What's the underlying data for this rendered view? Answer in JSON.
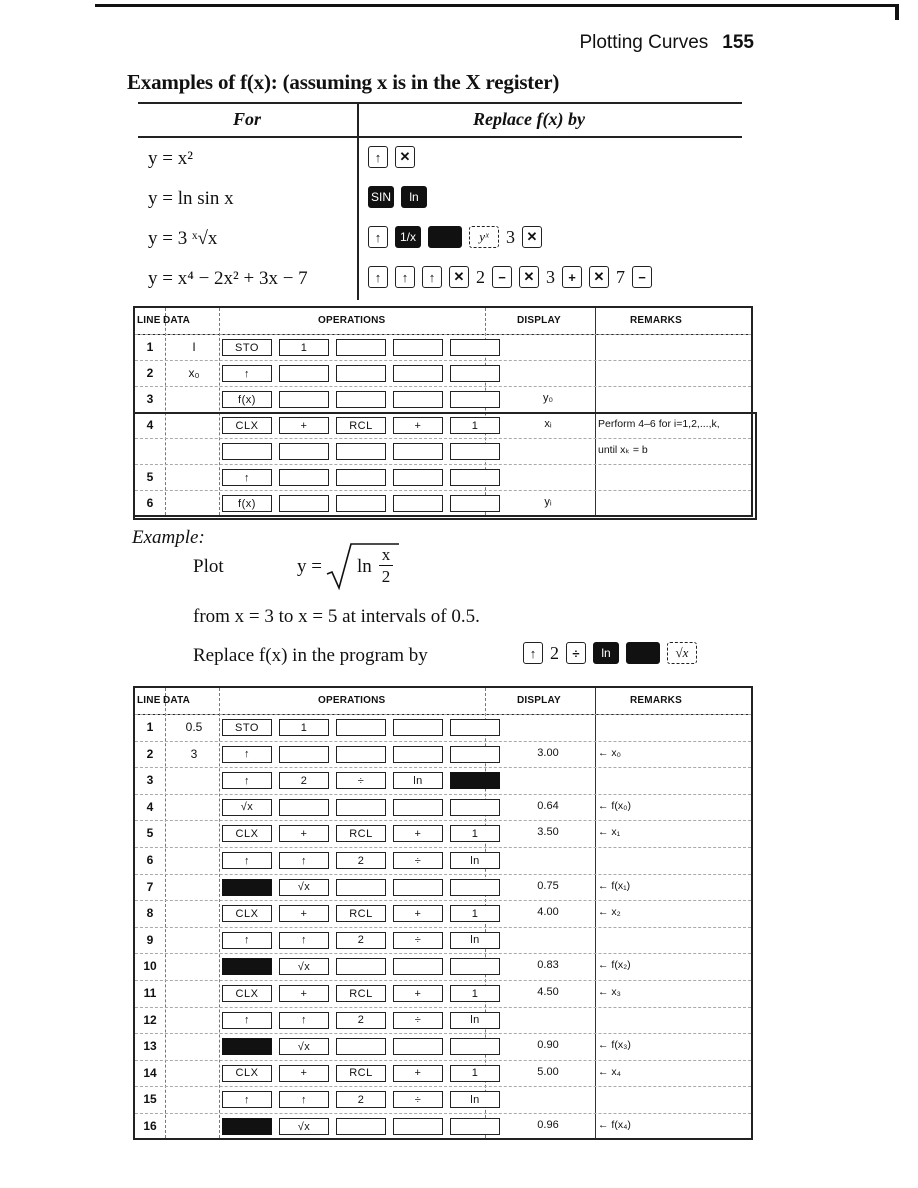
{
  "header": {
    "section": "Plotting Curves",
    "page_number": "155"
  },
  "examples": {
    "title": "Examples of f(x): (assuming x is in the X register)",
    "col_for": "For",
    "col_replace": "Replace f(x) by",
    "rows": [
      {
        "formula": "y = x²",
        "keys": [
          {
            "type": "key",
            "label": "↑"
          },
          {
            "type": "key",
            "label": "✕"
          }
        ]
      },
      {
        "formula": "y = ln sin x",
        "keys": [
          {
            "type": "dark",
            "label": "SIN"
          },
          {
            "type": "dark",
            "label": "ln"
          }
        ]
      },
      {
        "formula": "y = 3 ˣ√x",
        "keys": [
          {
            "type": "key",
            "label": "↑"
          },
          {
            "type": "dark",
            "label": "1/x"
          },
          {
            "type": "blank-dark",
            "label": ""
          },
          {
            "type": "dashed",
            "label": "yˣ"
          },
          {
            "type": "num",
            "label": "3"
          },
          {
            "type": "key",
            "label": "✕"
          }
        ]
      },
      {
        "formula": "y = x⁴ − 2x² + 3x − 7",
        "keys": [
          {
            "type": "key",
            "label": "↑"
          },
          {
            "type": "key",
            "label": "↑"
          },
          {
            "type": "key",
            "label": "↑"
          },
          {
            "type": "key",
            "label": "✕"
          },
          {
            "type": "num",
            "label": "2"
          },
          {
            "type": "key",
            "label": "−"
          },
          {
            "type": "key",
            "label": "✕"
          },
          {
            "type": "num",
            "label": "3"
          },
          {
            "type": "key",
            "label": "+"
          },
          {
            "type": "key",
            "label": "✕"
          },
          {
            "type": "num",
            "label": "7"
          },
          {
            "type": "key",
            "label": "−"
          }
        ]
      }
    ]
  },
  "program1": {
    "headers": {
      "line": "LINE",
      "data": "DATA",
      "operations": "OPERATIONS",
      "display": "DISPLAY",
      "remarks": "REMARKS"
    },
    "rows": [
      {
        "line": "1",
        "data": "I",
        "ops": [
          "STO",
          "1",
          "",
          "",
          ""
        ],
        "display": "",
        "remark": ""
      },
      {
        "line": "2",
        "data": "x₀",
        "ops": [
          "↑",
          "",
          "",
          "",
          ""
        ],
        "display": "",
        "remark": ""
      },
      {
        "line": "3",
        "data": "",
        "ops": [
          "f(x)",
          "",
          "",
          "",
          ""
        ],
        "display": "y₀",
        "remark": ""
      },
      {
        "line": "4",
        "data": "",
        "ops": [
          "CLX",
          "+",
          "RCL",
          "+",
          "1"
        ],
        "display": "xᵢ",
        "remark": "Perform 4–6 for i=1,2,...,k,"
      },
      {
        "line": "",
        "data": "",
        "ops": [
          "",
          "",
          "",
          "",
          ""
        ],
        "display": "",
        "remark": "until xₖ = b"
      },
      {
        "line": "5",
        "data": "",
        "ops": [
          "↑",
          "",
          "",
          "",
          ""
        ],
        "display": "",
        "remark": ""
      },
      {
        "line": "6",
        "data": "",
        "ops": [
          "f(x)",
          "",
          "",
          "",
          ""
        ],
        "display": "yᵢ",
        "remark": ""
      }
    ]
  },
  "example": {
    "label": "Example:",
    "plot_word": "Plot",
    "formula_lhs": "y =",
    "formula_ln": "ln",
    "formula_num": "x",
    "formula_den": "2",
    "range_text": "from x = 3 to x = 5 at intervals of 0.5.",
    "replace_text": "Replace f(x) in the program by",
    "replace_keys": [
      {
        "type": "key",
        "label": "↑"
      },
      {
        "type": "num",
        "label": "2"
      },
      {
        "type": "key",
        "label": "÷"
      },
      {
        "type": "dark",
        "label": "ln"
      },
      {
        "type": "blank-dark",
        "label": ""
      },
      {
        "type": "dashed",
        "label": "√x"
      }
    ]
  },
  "program2": {
    "headers": {
      "line": "LINE",
      "data": "DATA",
      "operations": "OPERATIONS",
      "display": "DISPLAY",
      "remarks": "REMARKS"
    },
    "rows": [
      {
        "line": "1",
        "data": "0.5",
        "ops": [
          "STO",
          "1",
          "",
          "",
          ""
        ],
        "display": "",
        "remark": ""
      },
      {
        "line": "2",
        "data": "3",
        "ops": [
          "↑",
          "",
          "",
          "",
          ""
        ],
        "display": "3.00",
        "remark": "← x₀"
      },
      {
        "line": "3",
        "data": "",
        "ops": [
          "↑",
          "2",
          "÷",
          "ln",
          "#"
        ],
        "display": "",
        "remark": ""
      },
      {
        "line": "4",
        "data": "",
        "ops": [
          "√x",
          "",
          "",
          "",
          ""
        ],
        "display": "0.64",
        "remark": "← f(x₀)"
      },
      {
        "line": "5",
        "data": "",
        "ops": [
          "CLX",
          "+",
          "RCL",
          "+",
          "1"
        ],
        "display": "3.50",
        "remark": "← x₁"
      },
      {
        "line": "6",
        "data": "",
        "ops": [
          "↑",
          "↑",
          "2",
          "÷",
          "ln"
        ],
        "display": "",
        "remark": ""
      },
      {
        "line": "7",
        "data": "",
        "ops": [
          "#",
          "√x",
          "",
          "",
          ""
        ],
        "display": "0.75",
        "remark": "← f(x₁)"
      },
      {
        "line": "8",
        "data": "",
        "ops": [
          "CLX",
          "+",
          "RCL",
          "+",
          "1"
        ],
        "display": "4.00",
        "remark": "← x₂"
      },
      {
        "line": "9",
        "data": "",
        "ops": [
          "↑",
          "↑",
          "2",
          "÷",
          "ln"
        ],
        "display": "",
        "remark": ""
      },
      {
        "line": "10",
        "data": "",
        "ops": [
          "#",
          "√x",
          "",
          "",
          ""
        ],
        "display": "0.83",
        "remark": "← f(x₂)"
      },
      {
        "line": "11",
        "data": "",
        "ops": [
          "CLX",
          "+",
          "RCL",
          "+",
          "1"
        ],
        "display": "4.50",
        "remark": "← x₃"
      },
      {
        "line": "12",
        "data": "",
        "ops": [
          "↑",
          "↑",
          "2",
          "÷",
          "ln"
        ],
        "display": "",
        "remark": ""
      },
      {
        "line": "13",
        "data": "",
        "ops": [
          "#",
          "√x",
          "",
          "",
          ""
        ],
        "display": "0.90",
        "remark": "← f(x₃)"
      },
      {
        "line": "14",
        "data": "",
        "ops": [
          "CLX",
          "+",
          "RCL",
          "+",
          "1"
        ],
        "display": "5.00",
        "remark": "← x₄"
      },
      {
        "line": "15",
        "data": "",
        "ops": [
          "↑",
          "↑",
          "2",
          "÷",
          "ln"
        ],
        "display": "",
        "remark": ""
      },
      {
        "line": "16",
        "data": "",
        "ops": [
          "#",
          "√x",
          "",
          "",
          ""
        ],
        "display": "0.96",
        "remark": "← f(x₄)"
      }
    ]
  }
}
